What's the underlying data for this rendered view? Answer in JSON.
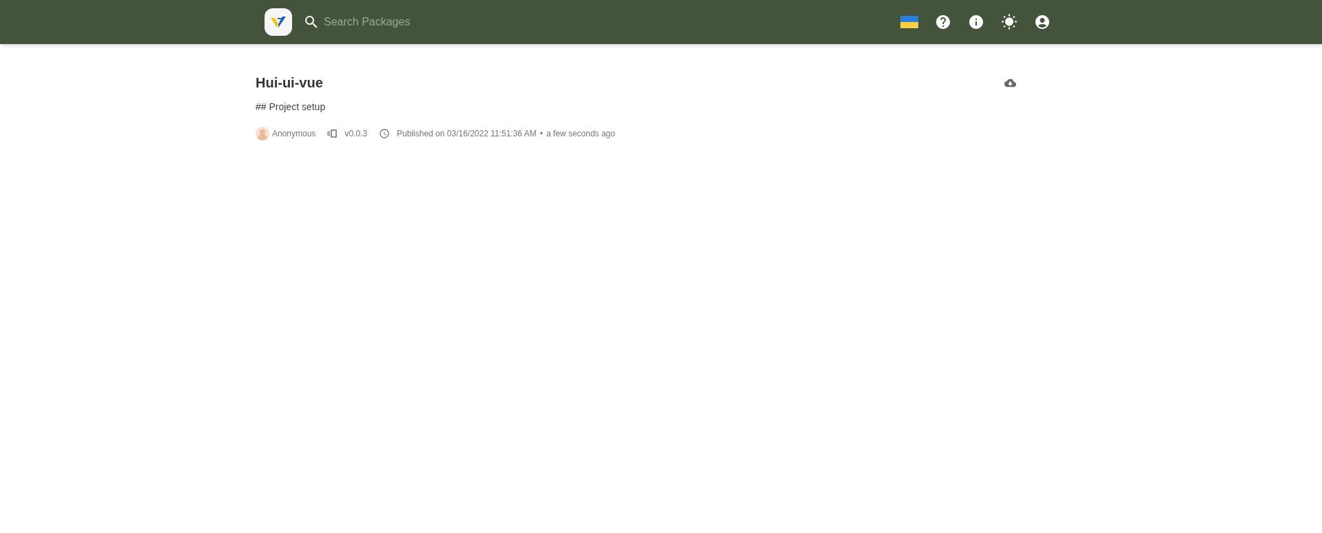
{
  "header": {
    "search": {
      "placeholder": "Search Packages"
    }
  },
  "package": {
    "name": "Hui-ui-vue",
    "description": "## Project setup",
    "author": "Anonymous",
    "version": "v0.0.3",
    "published": "Published on 03/16/2022 11:51:36 AM",
    "separator": "•",
    "relative_time": "a few seconds ago"
  }
}
